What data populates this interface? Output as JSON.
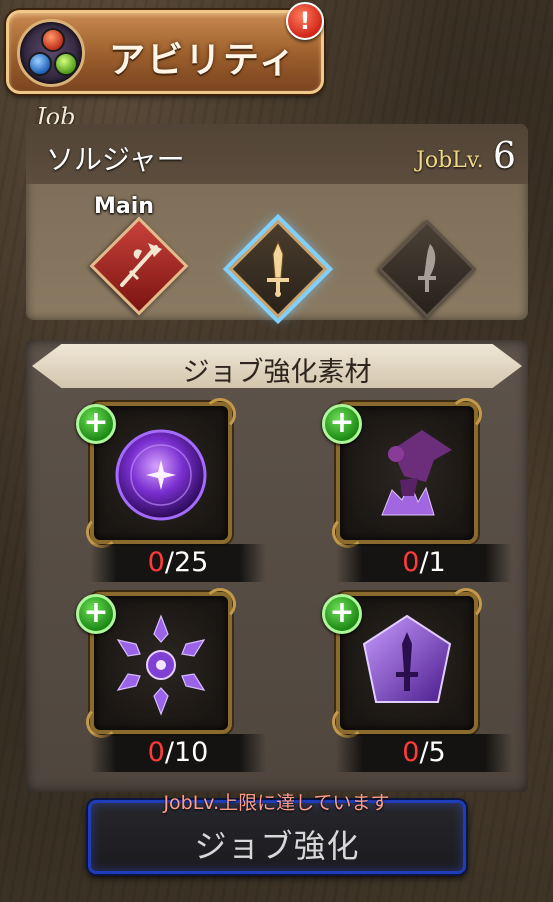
{
  "header": {
    "title": "アビリティ",
    "alert_badge": "!"
  },
  "job": {
    "caption": "Job",
    "name": "ソルジャー",
    "level_label": "JobLv.",
    "level_value": "6",
    "weapons": [
      {
        "name": "halberd",
        "tag": "Main",
        "state": "main"
      },
      {
        "name": "sword",
        "state": "selected"
      },
      {
        "name": "dagger",
        "state": "inactive"
      }
    ]
  },
  "materials": {
    "title": "ジョブ強化素材",
    "items": [
      {
        "icon": "purple-orb-icon",
        "have": "0",
        "need": "/25"
      },
      {
        "icon": "purple-dragon-icon",
        "have": "0",
        "need": "/1"
      },
      {
        "icon": "purple-snowflake-crystal-icon",
        "have": "0",
        "need": "/10"
      },
      {
        "icon": "purple-sword-gem-icon",
        "have": "0",
        "need": "/5"
      }
    ],
    "plus_symbol": "+"
  },
  "upgrade": {
    "note": "JobLv.上限に達しています",
    "label": "ジョブ強化"
  },
  "colors": {
    "accent_blue": "#7fd0ff",
    "count_red": "#ff3a3a",
    "plus_green": "#1e8a16",
    "button_border": "#1f3db8"
  }
}
